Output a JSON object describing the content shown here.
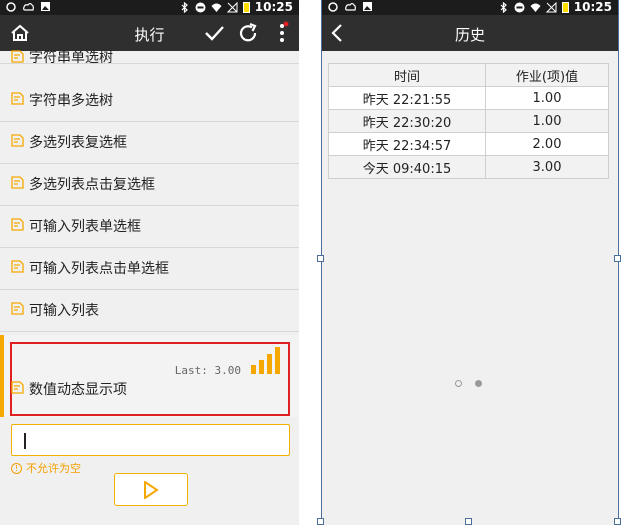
{
  "left": {
    "status": {
      "time": "10:25"
    },
    "appbar": {
      "title": "执行"
    },
    "items": [
      {
        "label": "字符串单选树"
      },
      {
        "label": "字符串多选树"
      },
      {
        "label": "多选列表复选框"
      },
      {
        "label": "多选列表点击复选框"
      },
      {
        "label": "可输入列表单选框"
      },
      {
        "label": "可输入列表点击单选框"
      },
      {
        "label": "可输入列表"
      }
    ],
    "selected": {
      "label": "数值动态显示项",
      "last": "Last: 3.00"
    },
    "input": {
      "value": "",
      "warning": "不允许为空"
    },
    "colors": {
      "accent": "#f5a800",
      "highlight": "#e02020",
      "appbar": "#2f2f2f"
    }
  },
  "right": {
    "status": {
      "time": "10:25"
    },
    "appbar": {
      "title": "历史"
    },
    "table": {
      "headers": [
        "时间",
        "作业(项)值"
      ],
      "rows": [
        [
          "昨天 22:21:55",
          "1.00"
        ],
        [
          "昨天 22:30:20",
          "1.00"
        ],
        [
          "昨天 22:34:57",
          "2.00"
        ],
        [
          "今天 09:40:15",
          "3.00"
        ]
      ]
    }
  }
}
